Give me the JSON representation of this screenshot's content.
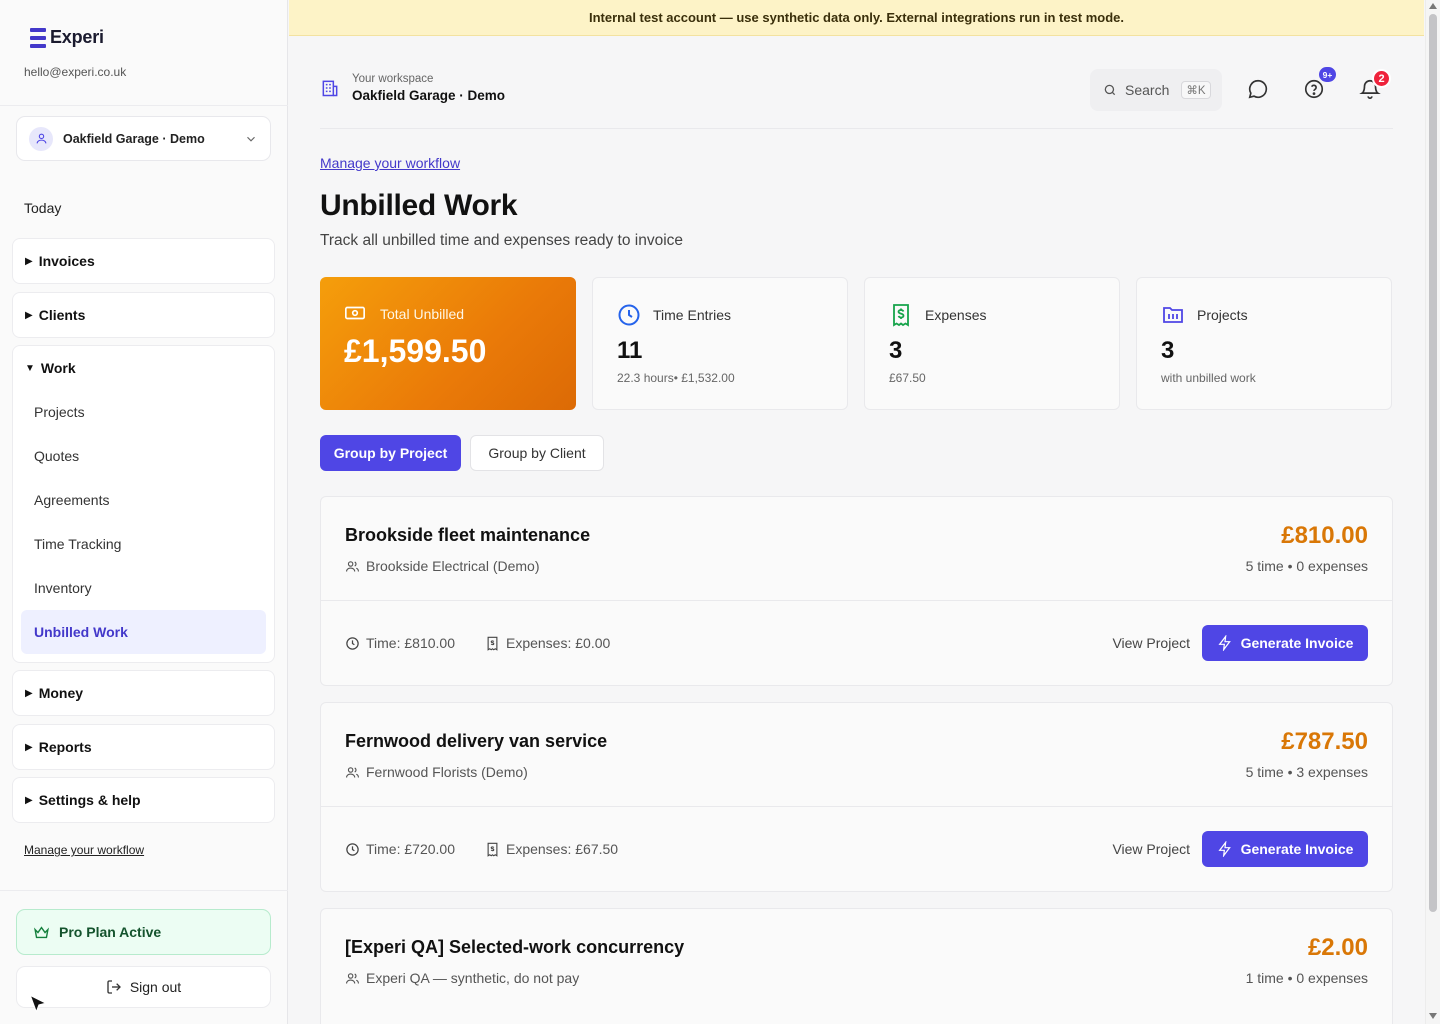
{
  "brand": {
    "name": "Experi",
    "email": "hello@experi.co.uk",
    "accent": "#4f46e5"
  },
  "workspace": {
    "selected": "Oakfield Garage · Demo",
    "label": "Your workspace",
    "title": "Oakfield Garage · Demo"
  },
  "banner": {
    "text": "Internal test account — use synthetic data only. External integrations run in test mode."
  },
  "sidebar": {
    "today": "Today",
    "groups": [
      {
        "label": "Invoices",
        "expanded": false
      },
      {
        "label": "Clients",
        "expanded": false
      },
      {
        "label": "Work",
        "expanded": true,
        "items": [
          "Projects",
          "Quotes",
          "Agreements",
          "Time Tracking",
          "Inventory",
          "Unbilled Work"
        ],
        "active": "Unbilled Work"
      },
      {
        "label": "Money",
        "expanded": false
      },
      {
        "label": "Reports",
        "expanded": false
      },
      {
        "label": "Settings & help",
        "expanded": false
      }
    ],
    "workflow_link": "Manage your workflow",
    "plan": "Pro Plan Active",
    "sign_out": "Sign out"
  },
  "header": {
    "search_label": "Search",
    "search_shortcut": "⌘K",
    "help_badge": "9+",
    "notif_badge": "2"
  },
  "page": {
    "workflow_link": "Manage your workflow",
    "title": "Unbilled Work",
    "subtitle": "Track all unbilled time and expenses ready to invoice"
  },
  "stats": [
    {
      "label": "Total Unbilled",
      "value": "£1,599.50",
      "note": "",
      "icon": "banknote-icon"
    },
    {
      "label": "Time Entries",
      "value": "11",
      "note": "22.3 hours• £1,532.00",
      "icon": "clock-icon"
    },
    {
      "label": "Expenses",
      "value": "3",
      "note": "£67.50",
      "icon": "receipt-icon"
    },
    {
      "label": "Projects",
      "value": "3",
      "note": "with unbilled work",
      "icon": "folder-icon"
    }
  ],
  "grouping": {
    "by_project": "Group by Project",
    "by_client": "Group by Client",
    "selected": "Group by Project"
  },
  "projects": [
    {
      "title": "Brookside fleet maintenance",
      "client": "Brookside Electrical (Demo)",
      "amount": "£810.00",
      "counts": "5 time • 0 expenses",
      "time": "Time: £810.00",
      "expenses": "Expenses: £0.00",
      "view": "View Project",
      "generate": "Generate Invoice"
    },
    {
      "title": "Fernwood delivery van service",
      "client": "Fernwood Florists (Demo)",
      "amount": "£787.50",
      "counts": "5 time • 3 expenses",
      "time": "Time: £720.00",
      "expenses": "Expenses: £67.50",
      "view": "View Project",
      "generate": "Generate Invoice"
    },
    {
      "title": "[Experi QA] Selected-work concurrency",
      "client": "Experi QA — synthetic, do not pay",
      "amount": "£2.00",
      "counts": "1 time • 0 expenses"
    }
  ]
}
